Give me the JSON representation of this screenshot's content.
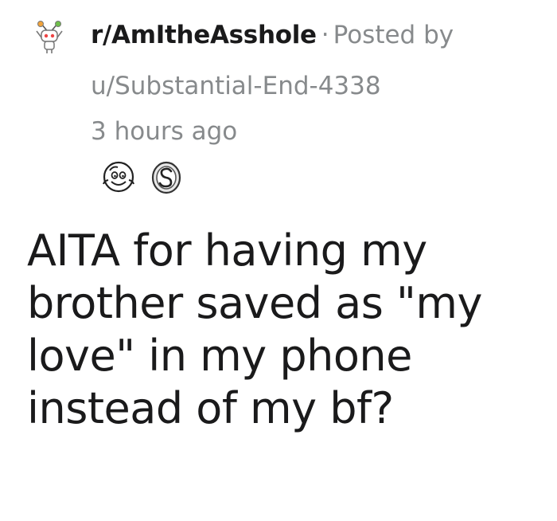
{
  "post": {
    "subreddit": "r/AmItheAsshole",
    "separator": "·",
    "posted_by_label": "Posted by",
    "username": "u/Substantial-End-4338",
    "timestamp": "3 hours ago",
    "awards": [
      {
        "icon": "wholesome-award-icon"
      },
      {
        "icon": "silver-award-icon"
      }
    ],
    "title_lines": [
      "AITA for having my",
      "brother saved as \"my",
      "love\" in my phone",
      "instead of my bf?"
    ]
  },
  "colors": {
    "primary_text": "#1a1a1b",
    "meta_text": "#878a8c"
  }
}
